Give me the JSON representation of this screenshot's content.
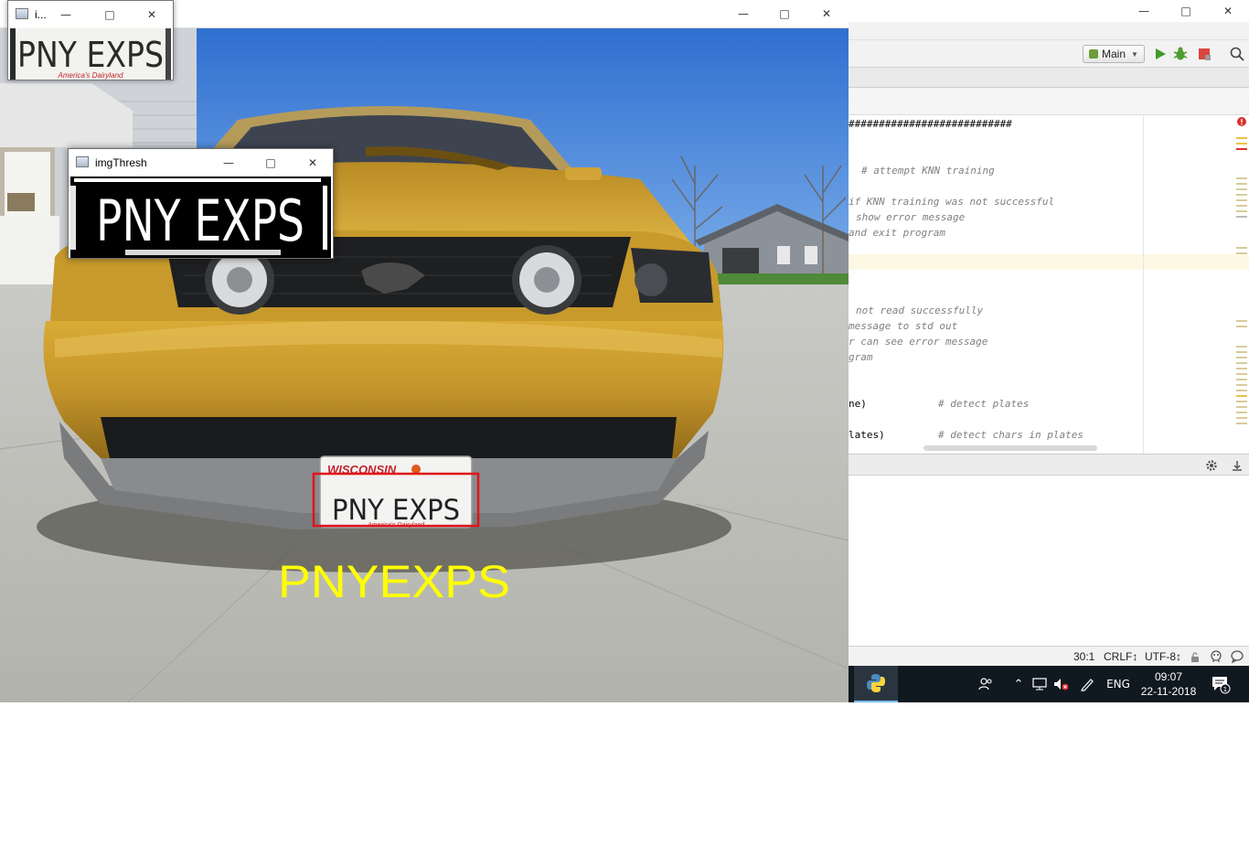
{
  "ide": {
    "run_config": "Main",
    "code_lines": [
      {
        "text": "###########################",
        "style": "plain"
      },
      {
        "text": "# attempt KNN training",
        "style": "comment"
      },
      {
        "text": "if KNN training was not successful",
        "style": "comment"
      },
      {
        "text": "show error message",
        "style": "comment"
      },
      {
        "text": "and exit program",
        "style": "comment"
      },
      {
        "text": "not read successfully",
        "style": "comment"
      },
      {
        "text": "message to std out",
        "style": "comment"
      },
      {
        "text": "r can see error message",
        "style": "comment"
      },
      {
        "text": "gram",
        "style": "comment"
      },
      {
        "text": "ne)",
        "style": "plain"
      },
      {
        "text": "# detect plates",
        "style": "comment"
      },
      {
        "text": "lates)",
        "style": "plain"
      },
      {
        "text": "# detect chars in plates",
        "style": "comment"
      }
    ],
    "status": {
      "position": "30:1",
      "line_sep": "CRLF↕",
      "encoding": "UTF-8↕"
    }
  },
  "taskbar": {
    "language": "ENG",
    "time": "09:07",
    "date": "22-11-2018",
    "notification_count": "1"
  },
  "windows": {
    "main": {
      "title": ""
    },
    "small": {
      "title": "i..."
    },
    "thresh": {
      "title": "imgThresh"
    }
  },
  "image": {
    "plate_state": "WISCONSIN",
    "plate_number": "PNY EXPS",
    "plate_slogan": "America's Dairyland",
    "recognized_text": "PNYEXPS"
  },
  "colors": {
    "recognized_text": "#ffff00",
    "plate_box": "#e0141a",
    "car_body": "#c99a2a",
    "sky": "#3d80d8",
    "taskbar": "#101820"
  }
}
